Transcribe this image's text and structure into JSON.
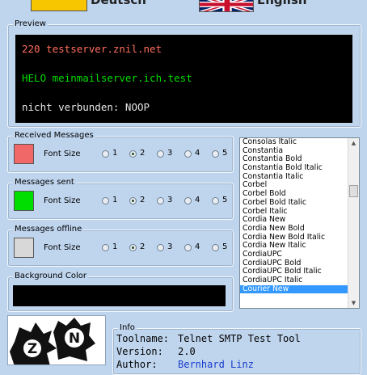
{
  "languages": {
    "german_label": "Deutsch",
    "english_label": "English"
  },
  "preview": {
    "title": "Preview",
    "lines": [
      {
        "text": "220 testserver.znil.net",
        "color": "#ff6e5e"
      },
      {
        "text": "HELO meinmailserver.ich.test",
        "color": "#00dd00"
      },
      {
        "text": "nicht verbunden: NOOP",
        "color": "#e6e6e6"
      }
    ]
  },
  "message_groups": [
    {
      "title": "Received Messages",
      "color": "#f06868",
      "font_size_label": "Font Size",
      "options": [
        "1",
        "2",
        "3",
        "4",
        "5"
      ],
      "selected": "2"
    },
    {
      "title": "Messages sent",
      "color": "#00dd00",
      "font_size_label": "Font Size",
      "options": [
        "1",
        "2",
        "3",
        "4",
        "5"
      ],
      "selected": "2"
    },
    {
      "title": "Messages offline",
      "color": "#d8d8d8",
      "font_size_label": "Font Size",
      "options": [
        "1",
        "2",
        "3",
        "4",
        "5"
      ],
      "selected": "2"
    }
  ],
  "background_color": {
    "title": "Background Color",
    "color": "#000000"
  },
  "font_list": {
    "items": [
      "Consolas Italic",
      "Constantia",
      "Constantia Bold",
      "Constantia Bold Italic",
      "Constantia Italic",
      "Corbel",
      "Corbel Bold",
      "Corbel Bold Italic",
      "Corbel Italic",
      "Cordia New",
      "Cordia New Bold",
      "Cordia New Bold Italic",
      "Cordia New Italic",
      "CordiaUPC",
      "CordiaUPC Bold",
      "CordiaUPC Bold Italic",
      "CordiaUPC Italic",
      "Courier New"
    ],
    "selected": "Courier New",
    "selected_color": "#3399ff"
  },
  "info": {
    "title": "Info",
    "rows": [
      {
        "label": "Toolname:",
        "value": "Telnet SMTP Test Tool"
      },
      {
        "label": "Version:",
        "value": "2.0"
      },
      {
        "label": "Author:",
        "value": "Bernhard Linz"
      }
    ]
  },
  "logo": {
    "text_left": "Z",
    "text_right": "N"
  }
}
